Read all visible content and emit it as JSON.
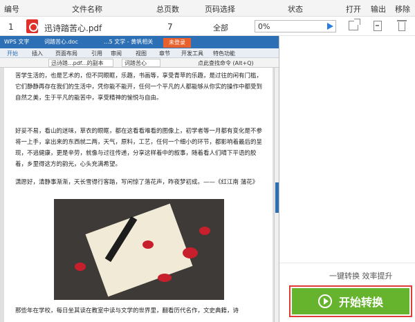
{
  "header": {
    "col_num": "编号",
    "col_name": "文件名称",
    "col_pages": "总页数",
    "col_range": "页码选择",
    "col_status": "状态",
    "col_open": "打开",
    "col_output": "输出",
    "col_remove": "移除"
  },
  "file_row": {
    "num": "1",
    "name": "迅诗踏苦心.pdf",
    "pages": "7",
    "range": "全部",
    "progress_text": "0%",
    "progress_value": 0,
    "file_icon": "pdf-icon"
  },
  "wps": {
    "logo": "WPS 文字",
    "title_tab1": "词踏苦心.doc",
    "title_tab2": "...5 文学 - 黄帆相关",
    "login": "未登录",
    "menu": [
      "开始",
      "插入",
      "页面布局",
      "引用",
      "审阅",
      "视图",
      "章节",
      "开发工具",
      "特色功能"
    ],
    "doc_tabs": [
      "迅诗踏...pdf...的副本",
      "词踏苦心"
    ],
    "search_hint": "点此查找命令 (Alt+Q)",
    "paragraphs": [
      "苦学生活的，也是艺术的，但不同眼眶，乐趣，书画等，享受青苹的乐趣，是过往的闲有门槛，它们静静再存在我们的生活中，凭你能不能开，任何一个平凡的人都能够从你实的操作中都受到自然之美，生于平凡的能苦中，享受精神的愉悦与自由。",
      "好妥不易，看山的迷味，草衣的眼眶，都在这看看难看的图像上，初学者等一月都有变化是不参将一上手，拿出来的东西就二两，天气，原料，工艺，任何一个细小的环节，都影响着最后的呈现，不逃健康，更是辛劳，就像与过往传递，分享这样着中的叙事，随着看人们晴下平语的胶着，乡里得这方的韵光，心头充满希望。",
      "潇愿好，清静事渐渐，天长雪得行客踏，写闲惊了落花声，昨夜梦初成。——《红江南 蒲花》",
      "那些年在学校，每日坐其读在教室中读与文学的世界里，翻看历代名作，文史典籍，诗"
    ]
  },
  "right_panel": {
    "slogan": "一键转换  效率提升",
    "start_label": "开始转换",
    "start_icon": "play-circle-icon"
  },
  "colors": {
    "accent_green": "#66b32e",
    "highlight_red": "#e03b30",
    "wps_blue": "#2d6fb4",
    "pdf_red": "#e0302a"
  }
}
